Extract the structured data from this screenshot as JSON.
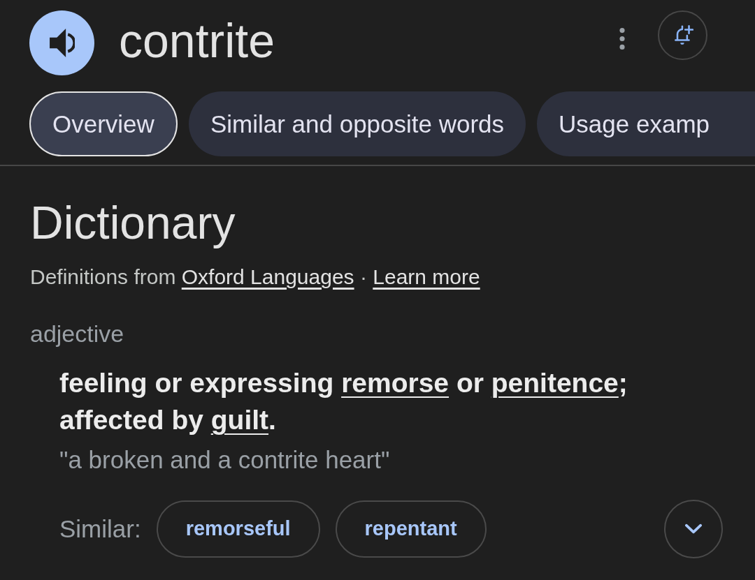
{
  "header": {
    "word": "contrite"
  },
  "tabs": [
    {
      "label": "Overview",
      "selected": true
    },
    {
      "label": "Similar and opposite words",
      "selected": false
    },
    {
      "label": "Usage examp",
      "selected": false
    }
  ],
  "dictionary": {
    "title": "Dictionary",
    "source": [
      {
        "kind": "text",
        "text": "Definitions from "
      },
      {
        "kind": "link",
        "text": "Oxford Languages"
      },
      {
        "kind": "text",
        "text": " · "
      },
      {
        "kind": "link",
        "text": "Learn more"
      }
    ],
    "part_of_speech": "adjective",
    "definition": [
      {
        "kind": "text",
        "text": "feeling or expressing "
      },
      {
        "kind": "link",
        "text": "remorse"
      },
      {
        "kind": "text",
        "text": " or "
      },
      {
        "kind": "link",
        "text": "penitence"
      },
      {
        "kind": "text",
        "text": "; affected by "
      },
      {
        "kind": "link",
        "text": "guilt"
      },
      {
        "kind": "text",
        "text": "."
      }
    ],
    "example": "\"a broken and a contrite heart\"",
    "similar": {
      "label": "Similar:",
      "words": [
        "remorseful",
        "repentant"
      ]
    }
  }
}
